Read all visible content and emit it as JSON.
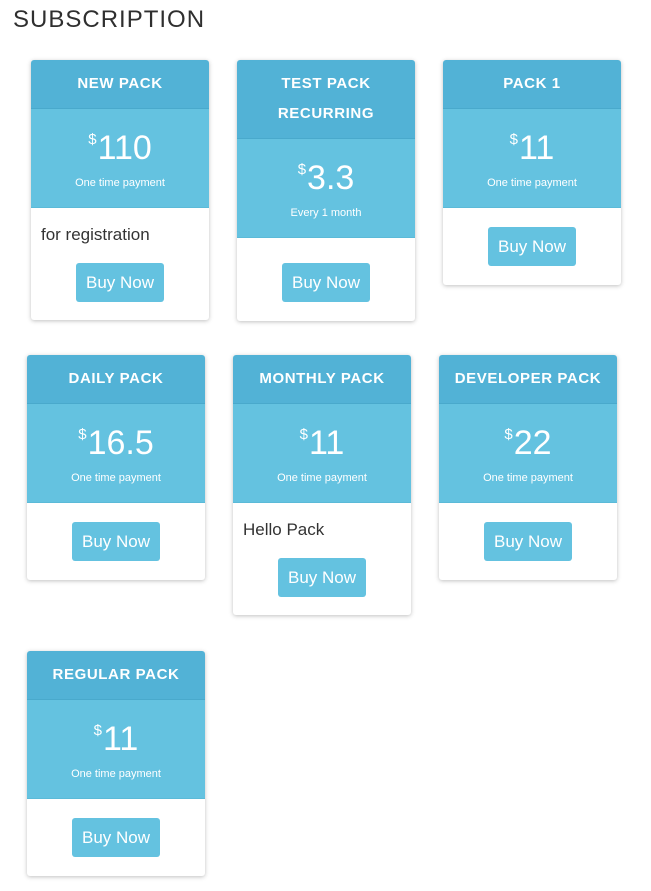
{
  "page": {
    "title": "SUBSCRIPTION"
  },
  "theme": {
    "header_color": "#52b2d6",
    "price_color": "#64c2e0",
    "button_color": "#64c2e0"
  },
  "packs": [
    {
      "name": "NEW PACK",
      "currency": "$",
      "price": "110",
      "period": "One time payment",
      "description": "for registration",
      "button": "Buy Now"
    },
    {
      "name": "TEST PACK RECURRING",
      "currency": "$",
      "price": "3.3",
      "period": "Every 1 month",
      "description": "",
      "button": "Buy Now"
    },
    {
      "name": "PACK 1",
      "currency": "$",
      "price": "11",
      "period": "One time payment",
      "description": "",
      "button": "Buy Now"
    },
    {
      "name": "DAILY PACK",
      "currency": "$",
      "price": "16.5",
      "period": "One time payment",
      "description": "",
      "button": "Buy Now"
    },
    {
      "name": "MONTHLY PACK",
      "currency": "$",
      "price": "11",
      "period": "One time payment",
      "description": "Hello Pack",
      "button": "Buy Now"
    },
    {
      "name": "DEVELOPER PACK",
      "currency": "$",
      "price": "22",
      "period": "One time payment",
      "description": "",
      "button": "Buy Now"
    },
    {
      "name": "REGULAR PACK",
      "currency": "$",
      "price": "11",
      "period": "One time payment",
      "description": "",
      "button": "Buy Now"
    }
  ]
}
